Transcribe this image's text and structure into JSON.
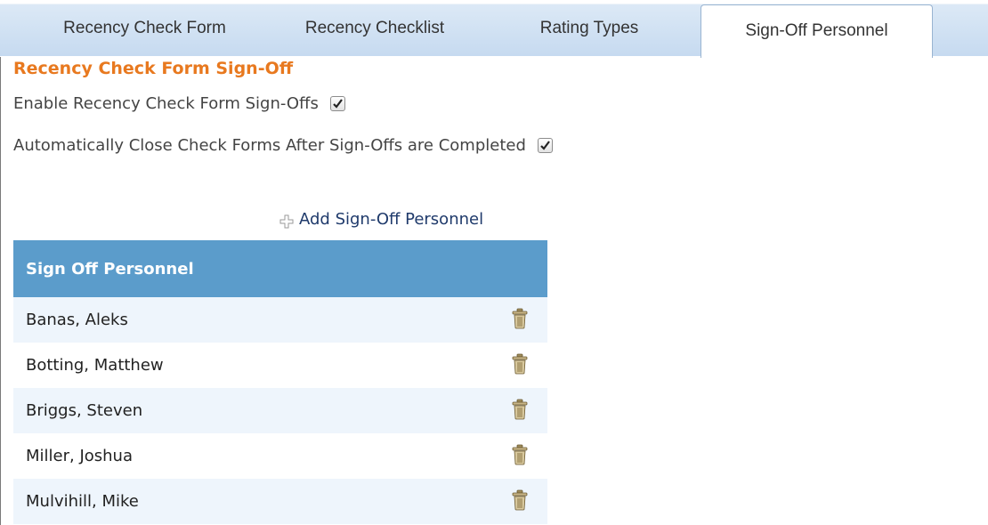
{
  "tabs": [
    {
      "label": "Recency Check Form"
    },
    {
      "label": "Recency Checklist"
    },
    {
      "label": "Rating Types"
    },
    {
      "label": "Sign-Off Personnel"
    }
  ],
  "active_tab": "Sign-Off Personnel",
  "section": {
    "title": "Recency Check Form Sign-Off",
    "options": [
      {
        "label": "Enable Recency Check Form Sign-Offs",
        "checked": true
      },
      {
        "label": "Automatically Close Check Forms After Sign-Offs are Completed",
        "checked": true
      }
    ]
  },
  "add_link": {
    "label": "Add Sign-Off Personnel",
    "icon": "plus-icon"
  },
  "table": {
    "header": "Sign Off Personnel",
    "rows": [
      {
        "name": "Banas, Aleks"
      },
      {
        "name": "Botting, Matthew"
      },
      {
        "name": "Briggs, Steven"
      },
      {
        "name": "Miller, Joshua"
      },
      {
        "name": "Mulvihill, Mike"
      }
    ],
    "row_action_icon": "trash-icon"
  },
  "colors": {
    "section_title": "#e8791f",
    "table_header_bg": "#5b9ccb",
    "row_alt_bg": "#eef5fc",
    "tab_bar_bg": "#c6daf0"
  }
}
